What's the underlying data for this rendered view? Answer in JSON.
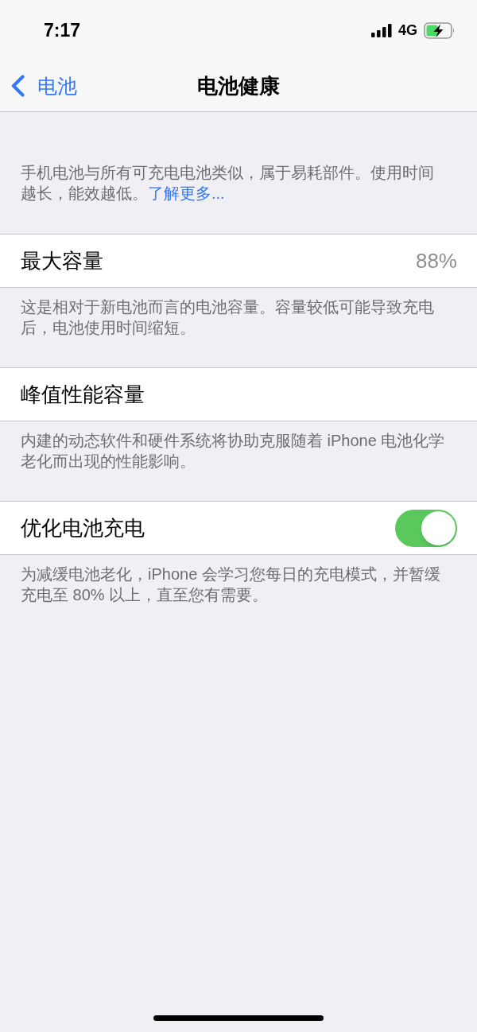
{
  "status_bar": {
    "time": "7:17",
    "network": "4G"
  },
  "nav": {
    "back_label": "电池",
    "title": "电池健康"
  },
  "intro": {
    "text": "手机电池与所有可充电电池类似，属于易耗部件。使用时间越长，能效越低。",
    "link": "了解更多..."
  },
  "sections": [
    {
      "kind": "value",
      "label": "最大容量",
      "value": "88%",
      "footer": "这是相对于新电池而言的电池容量。容量较低可能导致充电后，电池使用时间缩短。"
    },
    {
      "kind": "plain",
      "label": "峰值性能容量",
      "footer": "内建的动态软件和硬件系统将协助克服随着 iPhone 电池化学老化而出现的性能影响。"
    },
    {
      "kind": "toggle",
      "label": "优化电池充电",
      "on": true,
      "footer": "为减缓电池老化，iPhone 会学习您每日的充电模式，并暂缓充电至 80% 以上，直至您有需要。"
    }
  ]
}
